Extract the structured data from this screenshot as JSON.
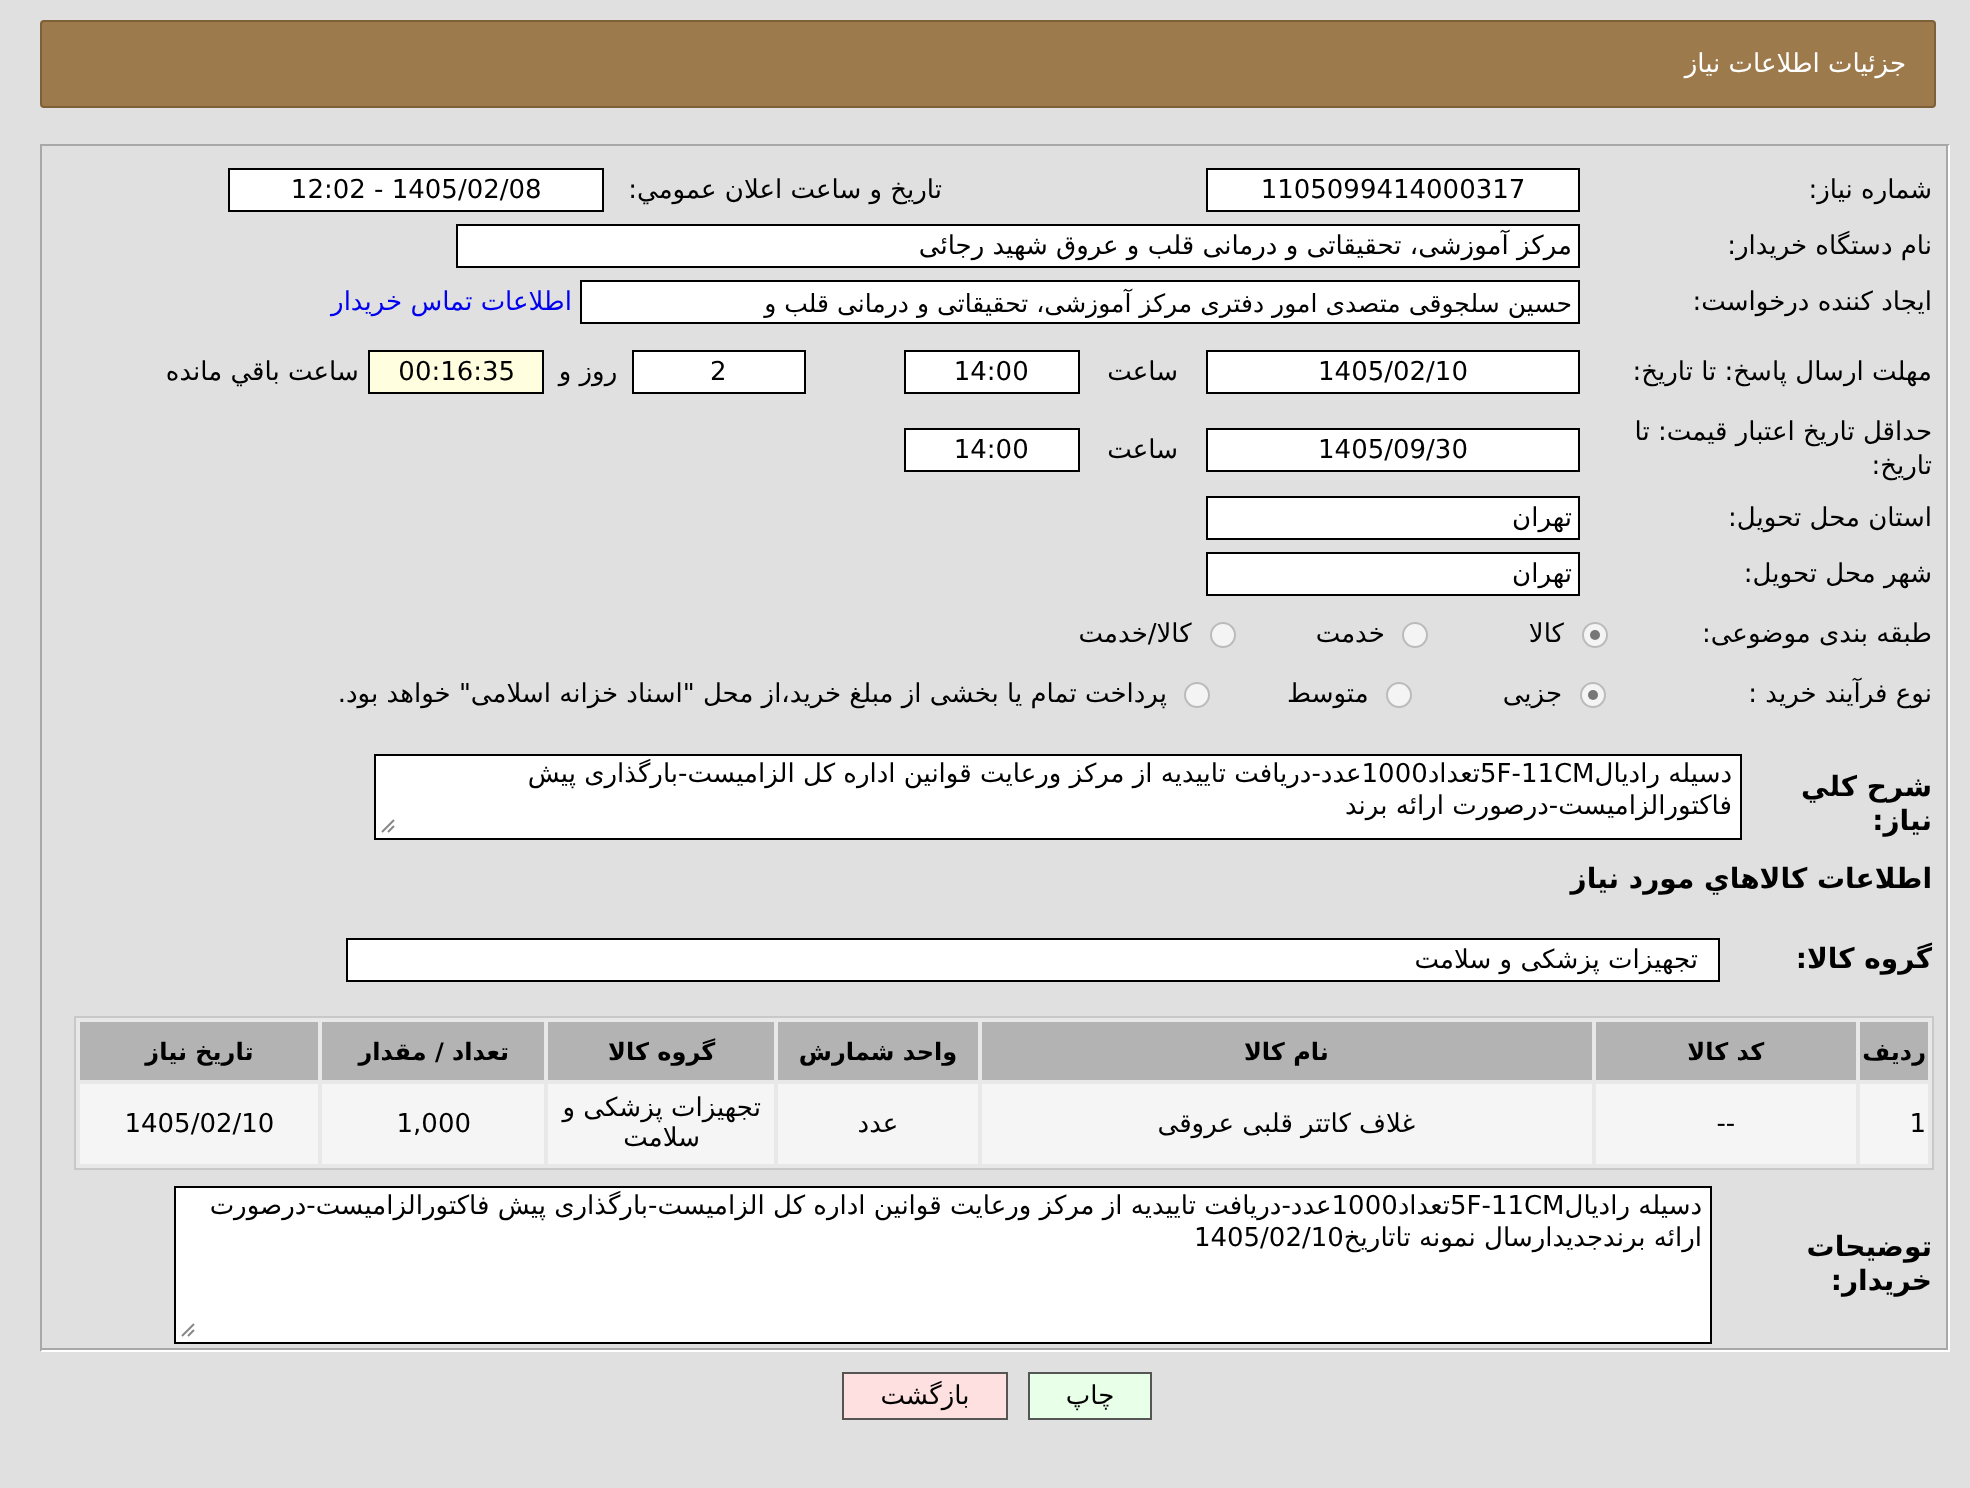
{
  "header": {
    "title": "جزئیات اطلاعات نیاز"
  },
  "need_number": {
    "label": "شماره نیاز:",
    "value": "1105099414000317"
  },
  "announce": {
    "label": "تاريخ و ساعت اعلان عمومي:",
    "value": "1405/02/08 - 12:02"
  },
  "buyer": {
    "label": "نام دستگاه خریدار:",
    "value": "مرکز آموزشی، تحقیقاتی و درمانی قلب و عروق شهید رجائی"
  },
  "creator": {
    "label": "ایجاد کننده درخواست:",
    "value": "حسین سلجوقی متصدی امور دفتری مرکز آموزشی، تحقیقاتی و درمانی قلب و",
    "link": "اطلاعات تماس خریدار"
  },
  "reply_deadline": {
    "label": "مهلت ارسال پاسخ: تا تاریخ:",
    "date": "1405/02/10",
    "time_label": "ساعت",
    "time": "14:00",
    "days": "2",
    "days_label": "روز و",
    "remaining": "00:16:35",
    "remaining_label": "ساعت باقي مانده"
  },
  "price_validity": {
    "label": "حداقل تاریخ اعتبار قیمت: تا تاریخ:",
    "date": "1405/09/30",
    "time_label": "ساعت",
    "time": "14:00"
  },
  "province": {
    "label": "استان محل تحویل:",
    "value": "تهران"
  },
  "city": {
    "label": "شهر محل تحویل:",
    "value": "تهران"
  },
  "category": {
    "label": "طبقه بندی موضوعی:",
    "options": [
      {
        "label": "کالا",
        "selected": true
      },
      {
        "label": "خدمت",
        "selected": false
      },
      {
        "label": "کالا/خدمت",
        "selected": false
      }
    ]
  },
  "purchase_type": {
    "label": "نوع فرآیند خرید :",
    "options": [
      {
        "label": "جزیی",
        "selected": true
      },
      {
        "label": "متوسط",
        "selected": false
      },
      {
        "label": "پرداخت تمام یا بخشی از مبلغ خرید،از محل \"اسناد خزانه اسلامی\" خواهد بود.",
        "selected": false
      }
    ]
  },
  "description": {
    "label": "شرح كلي نیاز:",
    "value": "دسیله رادیال5F-11CMتعداد1000عدد-دریافت تاییدیه از مرکز ورعایت قوانین اداره کل الزامیست-بارگذاری پیش فاکتورالزامیست-درصورت ارائه برند"
  },
  "goods_heading": "اطلاعات كالاهاي مورد نياز",
  "goods_group": {
    "label": "گروه کالا:",
    "value": "تجهیزات پزشکی و سلامت"
  },
  "table": {
    "columns": [
      "ردیف",
      "کد کالا",
      "نام کالا",
      "واحد شمارش",
      "گروه کالا",
      "تعداد / مقدار",
      "تاریخ نیاز"
    ],
    "rows": [
      [
        "1",
        "--",
        "غلاف کاتتر قلبی عروقی",
        "عدد",
        "تجهیزات پزشکی و سلامت",
        "1,000",
        "1405/02/10"
      ]
    ]
  },
  "buyer_notes": {
    "label": "توضیحات خریدار:",
    "value": "دسیله رادیال5F-11CMتعداد1000عدد-دریافت تاییدیه از مرکز ورعایت قوانین اداره کل الزامیست-بارگذاری پیش فاکتورالزامیست-درصورت ارائه برندجدیدارسال نمونه تاتاریخ1405/02/10"
  },
  "buttons": [
    {
      "label": "چاپ",
      "kind": "print"
    },
    {
      "label": "بازگشت",
      "kind": "back"
    }
  ]
}
